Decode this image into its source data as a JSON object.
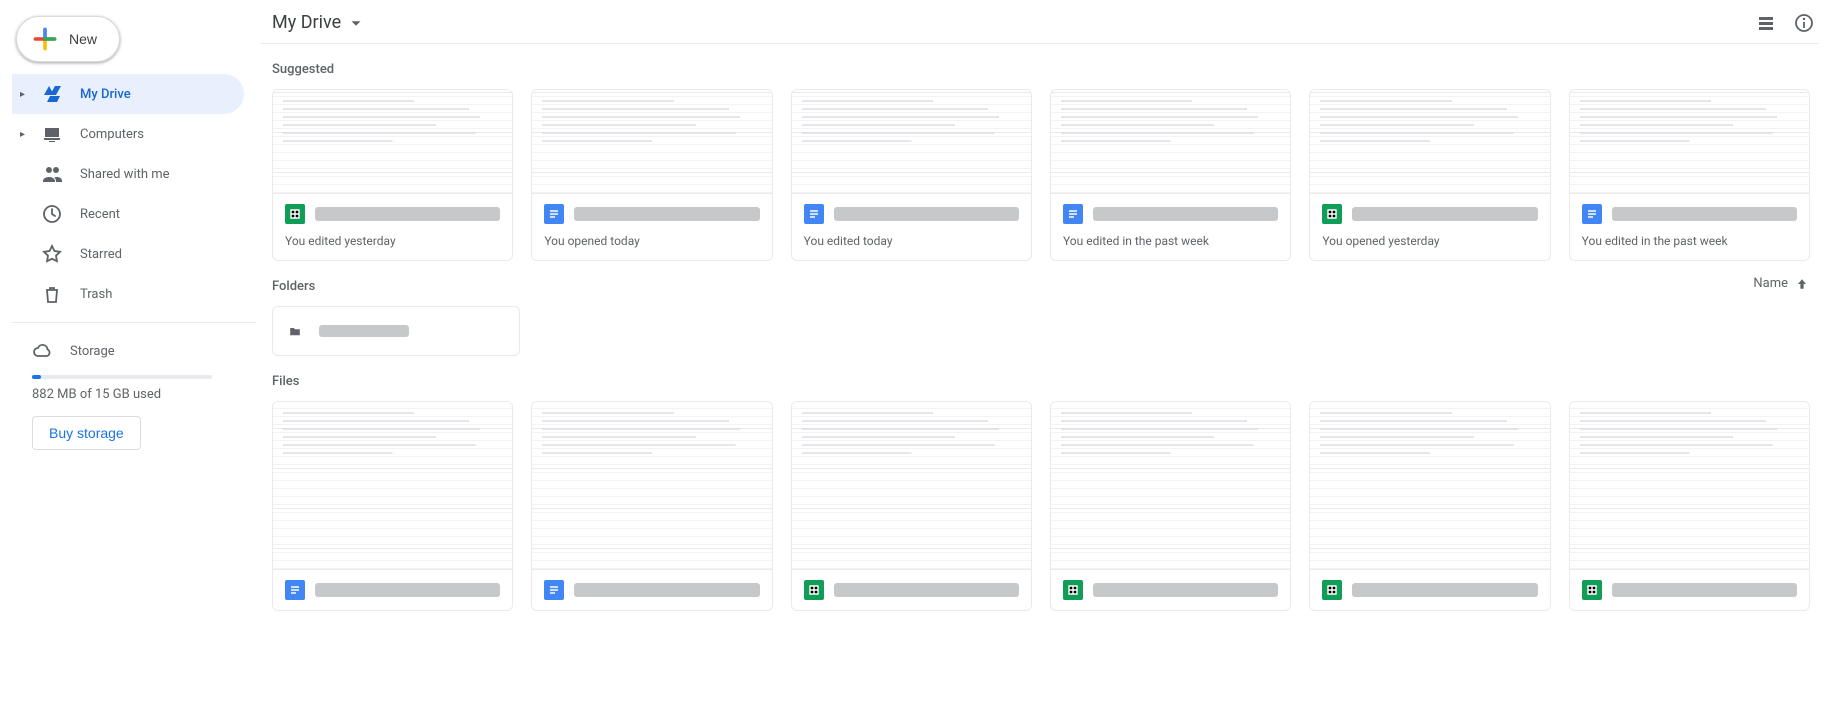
{
  "new_button_label": "New",
  "sidebar": {
    "items": [
      {
        "label": "My Drive",
        "expandable": true,
        "active": true
      },
      {
        "label": "Computers",
        "expandable": true,
        "active": false
      },
      {
        "label": "Shared with me",
        "expandable": false,
        "active": false
      },
      {
        "label": "Recent",
        "expandable": false,
        "active": false
      },
      {
        "label": "Starred",
        "expandable": false,
        "active": false
      },
      {
        "label": "Trash",
        "expandable": false,
        "active": false
      }
    ],
    "storage_label": "Storage",
    "storage_used_text": "882 MB of 15 GB used",
    "buy_label": "Buy storage"
  },
  "header": {
    "breadcrumb": "My Drive"
  },
  "sections": {
    "suggested_label": "Suggested",
    "folders_label": "Folders",
    "files_label": "Files",
    "sort_label": "Name"
  },
  "suggested": [
    {
      "type": "sheet",
      "subtitle": "You edited yesterday"
    },
    {
      "type": "doc",
      "subtitle": "You opened today"
    },
    {
      "type": "doc",
      "subtitle": "You edited today"
    },
    {
      "type": "doc",
      "subtitle": "You edited in the past week"
    },
    {
      "type": "sheet",
      "subtitle": "You opened yesterday"
    },
    {
      "type": "doc",
      "subtitle": "You edited in the past week"
    }
  ],
  "folders": [
    {
      "type": "folder"
    }
  ],
  "files": [
    {
      "type": "doc"
    },
    {
      "type": "doc"
    },
    {
      "type": "sheet"
    },
    {
      "type": "sheet"
    },
    {
      "type": "sheet"
    },
    {
      "type": "sheet"
    }
  ]
}
